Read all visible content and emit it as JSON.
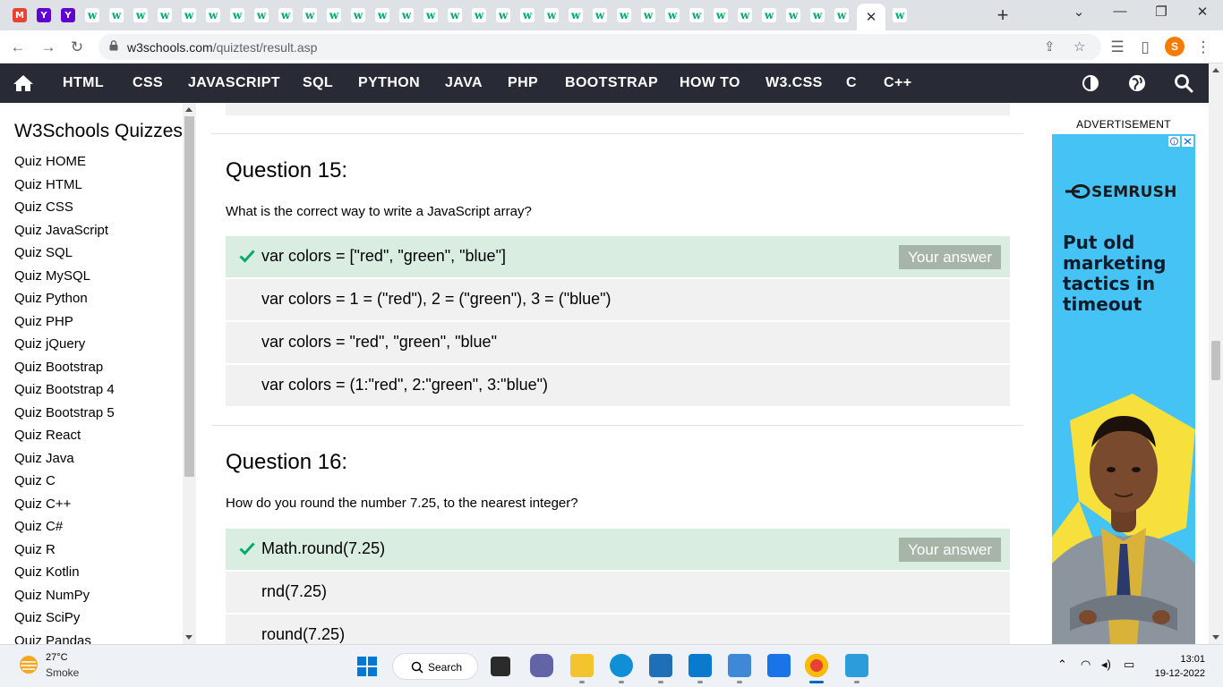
{
  "browser": {
    "url_host": "w3schools.com",
    "url_path": "/quiztest/result.asp",
    "profile_initial": "S",
    "favicons": [
      "gmail",
      "yahoo",
      "yahoo",
      "w3",
      "w3",
      "w3",
      "w3",
      "w3",
      "w3",
      "w3",
      "w3",
      "w3",
      "w3",
      "w3",
      "w3",
      "w3",
      "w3",
      "w3",
      "w3",
      "w3",
      "w3",
      "w3",
      "w3",
      "w3",
      "w3",
      "w3",
      "w3",
      "w3",
      "w3",
      "w3",
      "w3",
      "w3",
      "w3",
      "w3",
      "w3",
      "w3"
    ],
    "new_tab_symbol": "+",
    "close_tab_symbol": "✕"
  },
  "nav": {
    "items": [
      "HTML",
      "CSS",
      "JAVASCRIPT",
      "SQL",
      "PYTHON",
      "JAVA",
      "PHP",
      "BOOTSTRAP",
      "HOW TO",
      "W3.CSS",
      "C",
      "C++"
    ]
  },
  "sidebar": {
    "title": "W3Schools Quizzes",
    "items": [
      "Quiz HOME",
      "Quiz HTML",
      "Quiz CSS",
      "Quiz JavaScript",
      "Quiz SQL",
      "Quiz MySQL",
      "Quiz Python",
      "Quiz PHP",
      "Quiz jQuery",
      "Quiz Bootstrap",
      "Quiz Bootstrap 4",
      "Quiz Bootstrap 5",
      "Quiz React",
      "Quiz Java",
      "Quiz C",
      "Quiz C++",
      "Quiz C#",
      "Quiz R",
      "Quiz Kotlin",
      "Quiz NumPy",
      "Quiz SciPy",
      "Quiz Pandas"
    ]
  },
  "questions": [
    {
      "title": "Question 15:",
      "text": "What is the correct way to write a JavaScript array?",
      "options": [
        {
          "text": "var colors = [\"red\", \"green\", \"blue\"]",
          "correct": true,
          "badge": "Your answer"
        },
        {
          "text": "var colors = 1 = (\"red\"), 2 = (\"green\"), 3 = (\"blue\")",
          "correct": false
        },
        {
          "text": "var colors = \"red\", \"green\", \"blue\"",
          "correct": false
        },
        {
          "text": "var colors = (1:\"red\", 2:\"green\", 3:\"blue\")",
          "correct": false
        }
      ]
    },
    {
      "title": "Question 16:",
      "text": "How do you round the number 7.25, to the nearest integer?",
      "options": [
        {
          "text": "Math.round(7.25)",
          "correct": true,
          "badge": "Your answer"
        },
        {
          "text": "rnd(7.25)",
          "correct": false
        },
        {
          "text": "round(7.25)",
          "correct": false
        }
      ]
    }
  ],
  "ad": {
    "label": "ADVERTISEMENT",
    "brand": "SEMRUSH",
    "headline": "Put old marketing tactics in timeout"
  },
  "taskbar": {
    "weather_temp": "27°C",
    "weather_desc": "Smoke",
    "search_label": "Search",
    "time": "13:01",
    "date": "19-12-2022"
  },
  "colors": {
    "nav_bg": "#282a35",
    "correct_bg": "#d9eee1",
    "check": "#04aa6d",
    "badge_bg": "#a6b5a7",
    "option_bg": "#f1f1f1",
    "ad_bg": "#44c3f4"
  }
}
